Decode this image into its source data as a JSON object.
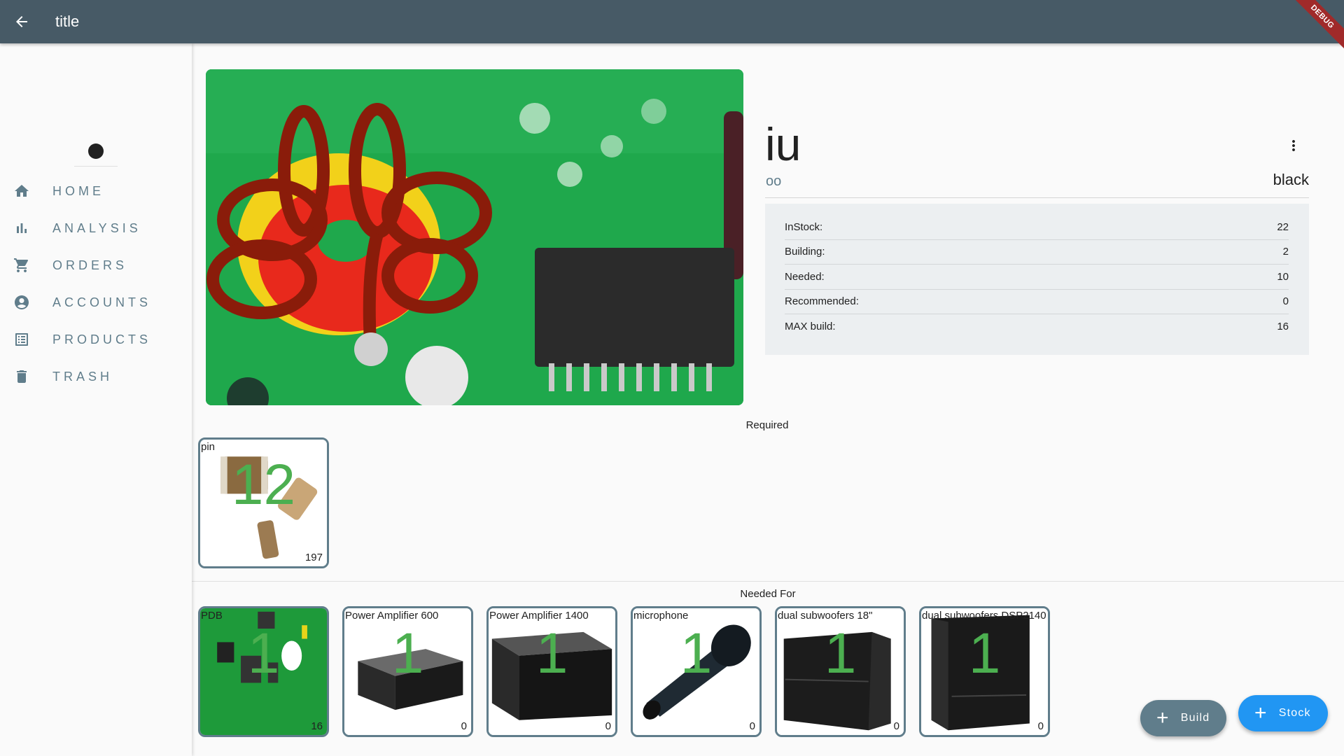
{
  "appbar": {
    "title": "title",
    "back_icon": "arrow-back-icon",
    "debug_banner": "DEBUG"
  },
  "sidebar": {
    "items": [
      {
        "label": "HOME",
        "icon": "home-icon"
      },
      {
        "label": "ANALYSIS",
        "icon": "bar-chart-icon"
      },
      {
        "label": "ORDERS",
        "icon": "cart-icon"
      },
      {
        "label": "ACCOUNTS",
        "icon": "account-circle-icon"
      },
      {
        "label": "PRODUCTS",
        "icon": "list-icon"
      },
      {
        "label": "TRASH",
        "icon": "trash-icon"
      }
    ]
  },
  "product": {
    "name": "iu",
    "subtitle": "oo",
    "color": "black",
    "image": "toroidal-inductor-pcb-photo",
    "stats": [
      {
        "label": "InStock:",
        "value": "22"
      },
      {
        "label": "Building:",
        "value": "2"
      },
      {
        "label": "Needed:",
        "value": "10"
      },
      {
        "label": "Recommended:",
        "value": "0"
      },
      {
        "label": "MAX build:",
        "value": "16"
      }
    ]
  },
  "required": {
    "label": "Required",
    "items": [
      {
        "name": "pin",
        "count": "12",
        "stock": "197",
        "image": "smd-capacitors-photo"
      }
    ]
  },
  "needed_for": {
    "label": "Needed For",
    "items": [
      {
        "name": "PDB",
        "count": "1",
        "stock": "16",
        "image": "green-pcb-photo"
      },
      {
        "name": "Power Amplifier 600",
        "count": "1",
        "stock": "0",
        "image": "power-amplifier-photo"
      },
      {
        "name": "Power Amplifier 1400",
        "count": "1",
        "stock": "0",
        "image": "power-amplifier-large-photo"
      },
      {
        "name": "microphone",
        "count": "1",
        "stock": "0",
        "image": "microphone-photo"
      },
      {
        "name": "dual subwoofers 18\"",
        "count": "1",
        "stock": "0",
        "image": "subwoofer-photo"
      },
      {
        "name": "dual subwoofers DSP2140",
        "count": "1",
        "stock": "0",
        "image": "subwoofer-dsp-photo"
      }
    ]
  },
  "actions": {
    "build_label": "Build",
    "stock_label": "Stock"
  },
  "colors": {
    "appbar": "#475a66",
    "primary": "#607d8b",
    "accent": "#2196f3",
    "count_green": "#4caf50",
    "debug_red": "#a02a2a"
  }
}
